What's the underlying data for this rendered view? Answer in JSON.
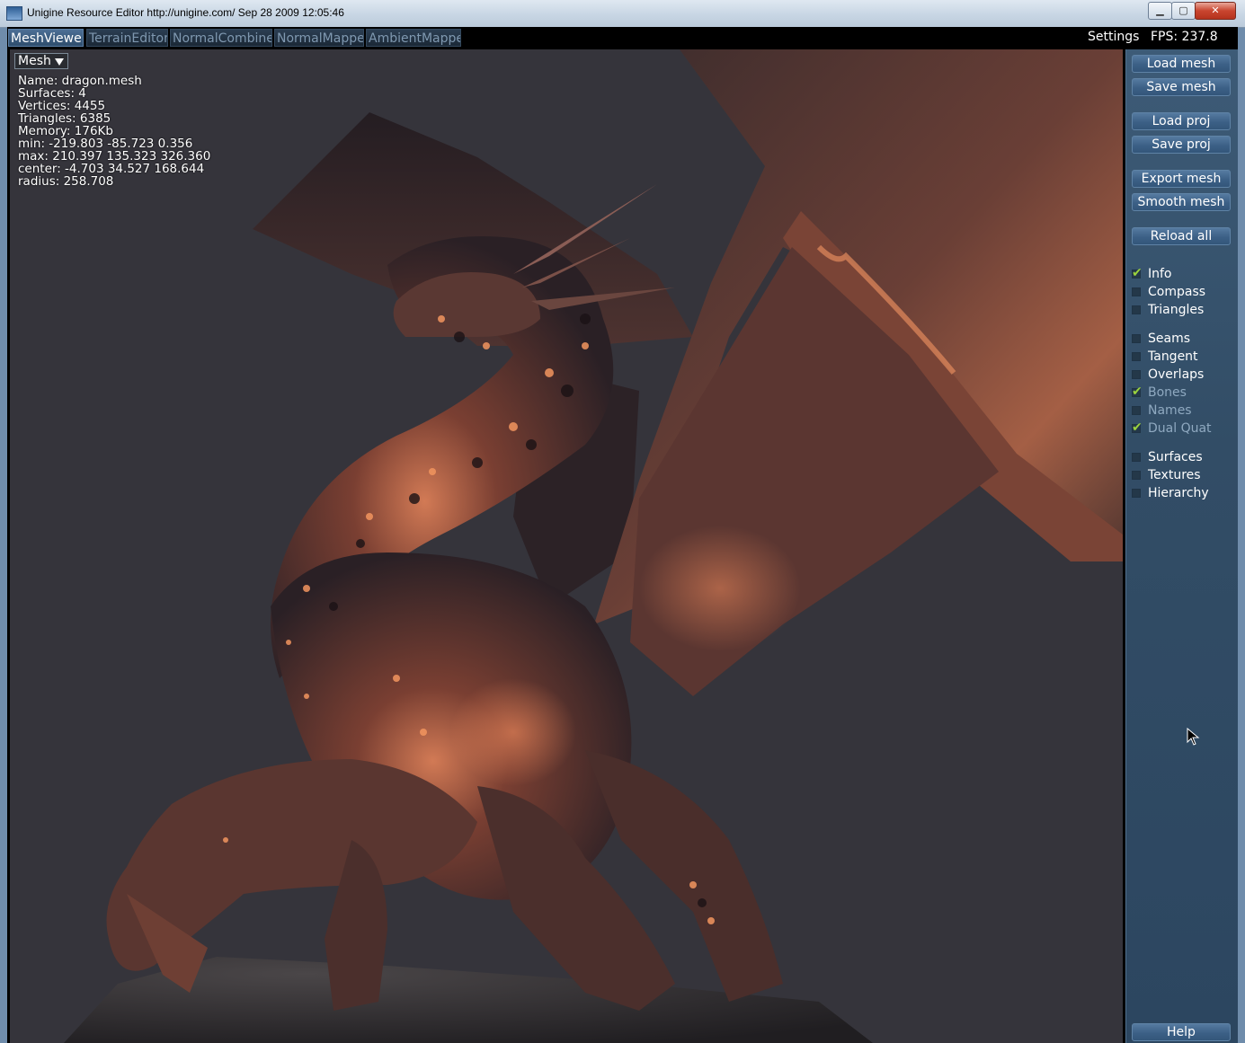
{
  "window": {
    "title": "Unigine Resource Editor http://unigine.com/ Sep 28 2009 12:05:46",
    "min_label": "▁",
    "max_label": "▢",
    "close_label": "✕"
  },
  "tabs": [
    {
      "label": "MeshViewer",
      "active": true
    },
    {
      "label": "TerrainEditor",
      "active": false
    },
    {
      "label": "NormalCombiner",
      "active": false
    },
    {
      "label": "NormalMapper",
      "active": false
    },
    {
      "label": "AmbientMapper",
      "active": false
    }
  ],
  "topbar": {
    "settings_label": "Settings",
    "fps_label": "FPS: 237.8"
  },
  "viewport": {
    "mode_selected": "Mesh",
    "info": {
      "name": "Name: dragon.mesh",
      "surfaces": "Surfaces: 4",
      "vertices": "Vertices: 4455",
      "triangles": "Triangles: 6385",
      "memory": "Memory: 176Kb",
      "min": "min: -219.803 -85.723 0.356",
      "max": "max: 210.397 135.323 326.360",
      "center": "center: -4.703 34.527 168.644",
      "radius": "radius: 258.708"
    }
  },
  "panel": {
    "buttons": {
      "load_mesh": "Load mesh",
      "save_mesh": "Save mesh",
      "load_proj": "Load proj",
      "save_proj": "Save proj",
      "export_mesh": "Export mesh",
      "smooth_mesh": "Smooth mesh",
      "reload_all": "Reload all",
      "help": "Help"
    },
    "checkboxes": {
      "info": {
        "label": "Info",
        "checked": true
      },
      "compass": {
        "label": "Compass",
        "checked": false
      },
      "triangles": {
        "label": "Triangles",
        "checked": false
      },
      "seams": {
        "label": "Seams",
        "checked": false
      },
      "tangent": {
        "label": "Tangent",
        "checked": false
      },
      "overlaps": {
        "label": "Overlaps",
        "checked": false
      },
      "bones": {
        "label": "Bones",
        "checked": true,
        "disabled": true
      },
      "names": {
        "label": "Names",
        "checked": false,
        "disabled": true
      },
      "dual_quat": {
        "label": "Dual Quat",
        "checked": true,
        "disabled": true
      },
      "surfaces": {
        "label": "Surfaces",
        "checked": false
      },
      "textures": {
        "label": "Textures",
        "checked": false
      },
      "hierarchy": {
        "label": "Hierarchy",
        "checked": false
      }
    },
    "check_mark": "✔"
  },
  "colors": {
    "viewport_bg": "#35343b",
    "panel_bg": "#324d66",
    "check_green": "#9ad23e",
    "dragon_copper": "#b0573a"
  },
  "icons": {
    "dropdown": "chevron-down-icon",
    "cursor": "mouse-pointer-icon"
  }
}
